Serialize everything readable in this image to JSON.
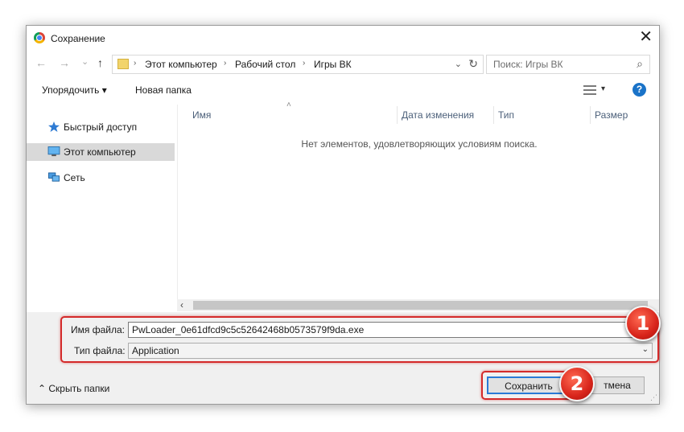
{
  "window": {
    "title": "Сохранение",
    "close_glyph": "✕"
  },
  "nav": {
    "back": "←",
    "forward": "→",
    "recent": "⌄",
    "up": "↑"
  },
  "address": {
    "crumbs": [
      "Этот компьютер",
      "Рабочий стол",
      "Игры ВК"
    ],
    "separator": "›",
    "dropdown": "⌄",
    "refresh": "↻"
  },
  "search": {
    "placeholder": "Поиск: Игры ВК",
    "icon": "⌕"
  },
  "toolbar": {
    "organize_label": "Упорядочить ▾",
    "new_folder_label": "Новая папка",
    "view_dropdown": "▾",
    "help": "?"
  },
  "sidebar": {
    "items": [
      {
        "label": "Быстрый доступ",
        "icon": "star-icon"
      },
      {
        "label": "Этот компьютер",
        "icon": "computer-icon",
        "selected": true
      },
      {
        "label": "Сеть",
        "icon": "network-icon"
      }
    ]
  },
  "content": {
    "sort_indicator": "˄",
    "columns": [
      "Имя",
      "Дата изменения",
      "Тип",
      "Размер"
    ],
    "empty_message": "Нет элементов, удовлетворяющих условиям поиска."
  },
  "scrollbar": {
    "left": "‹"
  },
  "form": {
    "filename_label": "Имя файла:",
    "filename_value": "PwLoader_0e61dfcd9c5c52642468b0573579f9da.exe",
    "filetype_label": "Тип файла:",
    "filetype_value": "Application",
    "filetype_dropdown": "⌄"
  },
  "footer": {
    "hide_folders_label": "⌃  Скрыть папки",
    "save_label": "Сохранить",
    "cancel_label": "тмена"
  },
  "annotations": {
    "badge1": "1",
    "badge2": "2",
    "highlight_color": "#d42a2a"
  }
}
